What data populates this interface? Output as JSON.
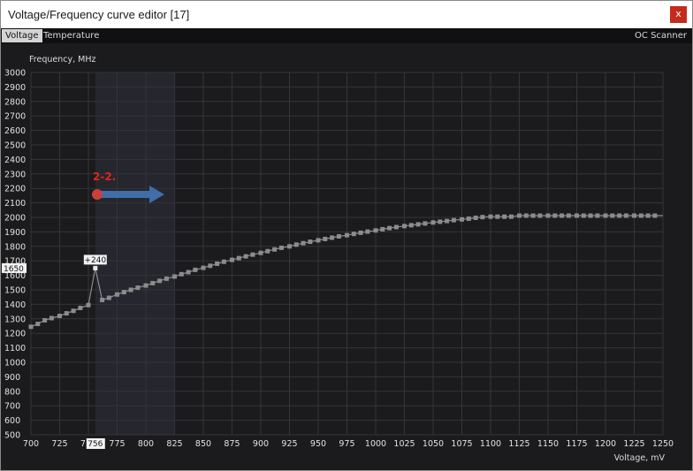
{
  "window": {
    "title": "Voltage/Frequency curve editor [17]",
    "close_label": "x"
  },
  "tabs": [
    {
      "label": "Voltage",
      "active": true
    },
    {
      "label": "Temperature",
      "active": false
    }
  ],
  "oc_scanner_label": "OC Scanner",
  "annotation": {
    "label": "2-2."
  },
  "selected_point": {
    "voltage": 756,
    "frequency": 1650,
    "offset_label": "+240",
    "voltage_label": "756",
    "frequency_label": "1650"
  },
  "colors": {
    "background": "#1b1b1d",
    "grid": "#353539",
    "curve": "#8c8c8c",
    "highlight_band": "#25262e",
    "annotation_dot": "#c8403c",
    "annotation_arrow": "#3f6ea8",
    "annotation_text": "#e1251b",
    "close_button": "#c42b1c"
  },
  "chart_data": {
    "type": "line",
    "xlabel": "Voltage, mV",
    "ylabel": "Frequency, MHz",
    "xlim": [
      700,
      1250
    ],
    "ylim": [
      500,
      3000
    ],
    "x_ticks": [
      700,
      725,
      750,
      775,
      800,
      825,
      850,
      875,
      900,
      925,
      950,
      975,
      1000,
      1025,
      1050,
      1075,
      1100,
      1125,
      1150,
      1175,
      1200,
      1225,
      1250
    ],
    "y_ticks": [
      500,
      600,
      700,
      800,
      900,
      1000,
      1100,
      1200,
      1300,
      1400,
      1500,
      1600,
      1700,
      1800,
      1900,
      2000,
      2100,
      2200,
      2300,
      2400,
      2500,
      2600,
      2700,
      2800,
      2900,
      3000
    ],
    "grid": true,
    "highlight_range": [
      756,
      825
    ],
    "series": [
      {
        "points": [
          [
            700,
            1245
          ],
          [
            706,
            1265
          ],
          [
            712,
            1290
          ],
          [
            718,
            1305
          ],
          [
            725,
            1320
          ],
          [
            731,
            1338
          ],
          [
            737,
            1355
          ],
          [
            743,
            1375
          ],
          [
            750,
            1395
          ],
          [
            756,
            1650
          ],
          [
            762,
            1430
          ],
          [
            768,
            1445
          ],
          [
            775,
            1468
          ],
          [
            781,
            1484
          ],
          [
            787,
            1500
          ],
          [
            793,
            1515
          ],
          [
            800,
            1530
          ],
          [
            806,
            1546
          ],
          [
            812,
            1562
          ],
          [
            818,
            1577
          ],
          [
            825,
            1592
          ],
          [
            831,
            1608
          ],
          [
            837,
            1622
          ],
          [
            843,
            1638
          ],
          [
            850,
            1652
          ],
          [
            856,
            1666
          ],
          [
            862,
            1680
          ],
          [
            868,
            1694
          ],
          [
            875,
            1707
          ],
          [
            881,
            1719
          ],
          [
            887,
            1731
          ],
          [
            893,
            1743
          ],
          [
            900,
            1755
          ],
          [
            906,
            1767
          ],
          [
            912,
            1779
          ],
          [
            918,
            1790
          ],
          [
            925,
            1800
          ],
          [
            931,
            1812
          ],
          [
            937,
            1822
          ],
          [
            943,
            1832
          ],
          [
            950,
            1842
          ],
          [
            956,
            1851
          ],
          [
            962,
            1860
          ],
          [
            968,
            1869
          ],
          [
            975,
            1877
          ],
          [
            981,
            1886
          ],
          [
            987,
            1894
          ],
          [
            993,
            1902
          ],
          [
            1000,
            1910
          ],
          [
            1006,
            1918
          ],
          [
            1012,
            1926
          ],
          [
            1018,
            1933
          ],
          [
            1025,
            1940
          ],
          [
            1031,
            1946
          ],
          [
            1037,
            1952
          ],
          [
            1043,
            1958
          ],
          [
            1050,
            1965
          ],
          [
            1056,
            1970
          ],
          [
            1062,
            1975
          ],
          [
            1068,
            1981
          ],
          [
            1075,
            1986
          ],
          [
            1081,
            1991
          ],
          [
            1087,
            1997
          ],
          [
            1093,
            2002
          ],
          [
            1100,
            2005
          ],
          [
            1106,
            2005
          ],
          [
            1112,
            2005
          ],
          [
            1118,
            2005
          ],
          [
            1125,
            2012
          ],
          [
            1131,
            2012
          ],
          [
            1137,
            2012
          ],
          [
            1143,
            2012
          ],
          [
            1150,
            2012
          ],
          [
            1156,
            2012
          ],
          [
            1162,
            2012
          ],
          [
            1168,
            2012
          ],
          [
            1175,
            2012
          ],
          [
            1181,
            2012
          ],
          [
            1187,
            2012
          ],
          [
            1193,
            2012
          ],
          [
            1200,
            2012
          ],
          [
            1206,
            2012
          ],
          [
            1212,
            2012
          ],
          [
            1218,
            2012
          ],
          [
            1225,
            2012
          ],
          [
            1231,
            2012
          ],
          [
            1237,
            2012
          ],
          [
            1243,
            2012
          ]
        ],
        "line_end": [
          1250,
          2012
        ]
      }
    ]
  }
}
